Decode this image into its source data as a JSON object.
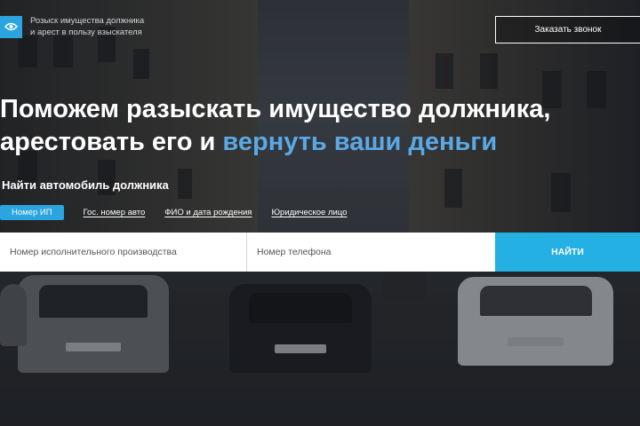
{
  "header": {
    "tagline_line1": "Розыск имущества должника",
    "tagline_line2": "и арест в пользу взыскателя",
    "logo_icon": "eye-icon",
    "call_button": "Заказать звонок"
  },
  "hero": {
    "title_line1": "Поможем разыскать имущество должника,",
    "title_line2_plain": "арестовать его и ",
    "title_line2_accent": "вернуть ваши деньги",
    "accent_color": "#5aa9e6"
  },
  "search": {
    "heading": "Найти автомобиль должника",
    "tabs": [
      {
        "label": "Номер ИП",
        "active": true
      },
      {
        "label": "Гос. номер авто",
        "active": false
      },
      {
        "label": "ФИО и дата рождения",
        "active": false
      },
      {
        "label": "Юридическое лицо",
        "active": false
      }
    ],
    "field1_placeholder": "Номер исполнительного производства",
    "field2_placeholder": "Номер телефона",
    "submit_label": "НАЙТИ",
    "accent_color": "#24b0e3"
  }
}
